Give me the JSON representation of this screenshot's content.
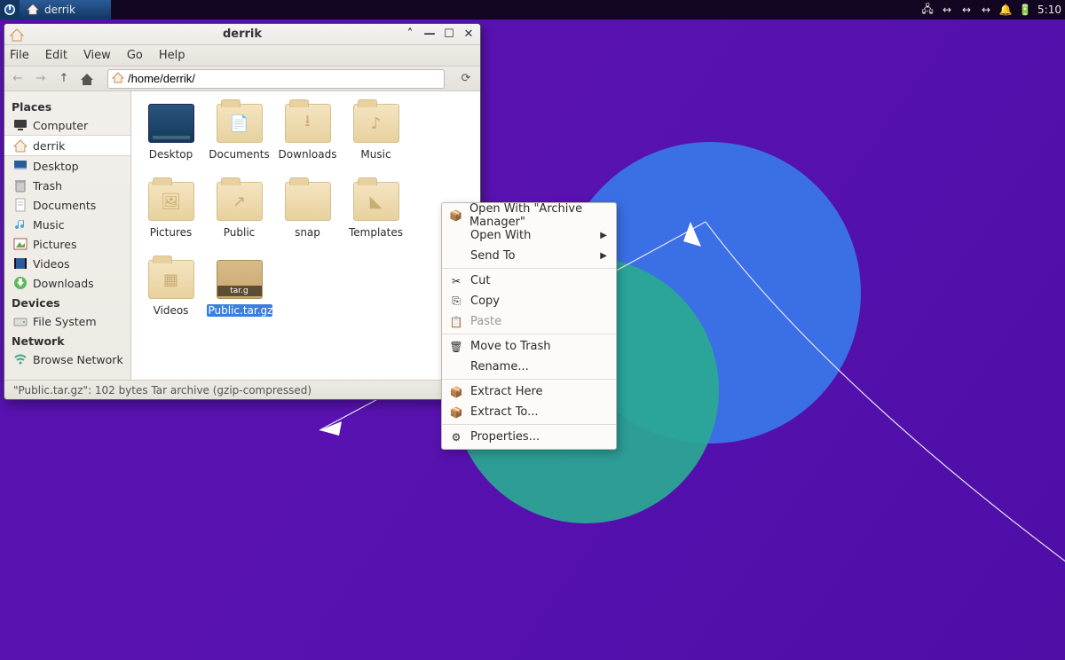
{
  "panel": {
    "task_label": "derrik",
    "clock": "5:10"
  },
  "window": {
    "title": "derrik",
    "menu": {
      "file": "File",
      "edit": "Edit",
      "view": "View",
      "go": "Go",
      "help": "Help"
    },
    "path": "/home/derrik/",
    "status": "\"Public.tar.gz\": 102 bytes Tar archive (gzip-compressed)"
  },
  "sidebar": {
    "section_places": "Places",
    "places": [
      {
        "label": "Computer",
        "icon": "monitor"
      },
      {
        "label": "derrik",
        "icon": "home",
        "selected": true
      },
      {
        "label": "Desktop",
        "icon": "desktop"
      },
      {
        "label": "Trash",
        "icon": "trash"
      },
      {
        "label": "Documents",
        "icon": "doc"
      },
      {
        "label": "Music",
        "icon": "music"
      },
      {
        "label": "Pictures",
        "icon": "pictures"
      },
      {
        "label": "Videos",
        "icon": "videos"
      },
      {
        "label": "Downloads",
        "icon": "download"
      }
    ],
    "section_devices": "Devices",
    "devices": [
      {
        "label": "File System",
        "icon": "drive"
      }
    ],
    "section_network": "Network",
    "network": [
      {
        "label": "Browse Network",
        "icon": "wifi"
      }
    ]
  },
  "files": [
    {
      "label": "Desktop",
      "kind": "desktop"
    },
    {
      "label": "Documents",
      "kind": "folder",
      "glyph": "📄"
    },
    {
      "label": "Downloads",
      "kind": "folder",
      "glyph": "⭳"
    },
    {
      "label": "Music",
      "kind": "folder",
      "glyph": "♪"
    },
    {
      "label": "Pictures",
      "kind": "folder",
      "glyph": "🖼"
    },
    {
      "label": "Public",
      "kind": "folder",
      "glyph": "↗"
    },
    {
      "label": "snap",
      "kind": "folder",
      "glyph": ""
    },
    {
      "label": "Templates",
      "kind": "folder",
      "glyph": "◣"
    },
    {
      "label": "Videos",
      "kind": "folder",
      "glyph": "▦"
    },
    {
      "label": "Public.tar.gz",
      "kind": "archive",
      "selected": true
    }
  ],
  "context_menu": [
    {
      "label": "Open With \"Archive Manager\"",
      "icon": "📦"
    },
    {
      "label": "Open With",
      "submenu": true
    },
    {
      "label": "Send To",
      "submenu": true
    },
    {
      "sep": true
    },
    {
      "label": "Cut",
      "icon": "✂"
    },
    {
      "label": "Copy",
      "icon": "⎘"
    },
    {
      "label": "Paste",
      "icon": "📋",
      "disabled": true
    },
    {
      "sep": true
    },
    {
      "label": "Move to Trash",
      "icon": "🗑"
    },
    {
      "label": "Rename..."
    },
    {
      "sep": true
    },
    {
      "label": "Extract Here",
      "icon": "📦"
    },
    {
      "label": "Extract To...",
      "icon": "📦"
    },
    {
      "sep": true
    },
    {
      "label": "Properties...",
      "icon": "⚙"
    }
  ]
}
